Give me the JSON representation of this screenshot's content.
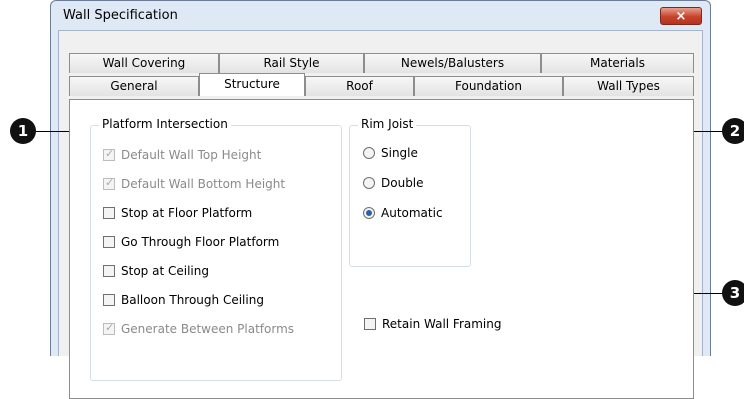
{
  "window": {
    "title": "Wall Specification",
    "close_glyph": "×"
  },
  "tabs_back": [
    "Wall Covering",
    "Rail Style",
    "Newels/Balusters",
    "Materials"
  ],
  "tabs_front": [
    "General",
    "Structure",
    "Roof",
    "Foundation",
    "Wall Types"
  ],
  "active_tab": "Structure",
  "platform_group": {
    "legend": "Platform Intersection",
    "items": [
      {
        "label": "Default Wall Top Height",
        "checked": true,
        "enabled": false
      },
      {
        "label": "Default Wall Bottom Height",
        "checked": true,
        "enabled": false
      },
      {
        "label": "Stop at Floor Platform",
        "checked": false,
        "enabled": true
      },
      {
        "label": "Go Through Floor Platform",
        "checked": false,
        "enabled": true
      },
      {
        "label": "Stop at Ceiling",
        "checked": false,
        "enabled": true
      },
      {
        "label": "Balloon Through Ceiling",
        "checked": false,
        "enabled": true
      },
      {
        "label": "Generate Between Platforms",
        "checked": true,
        "enabled": false
      }
    ]
  },
  "rim_group": {
    "legend": "Rim Joist",
    "options": [
      {
        "label": "Single",
        "selected": false
      },
      {
        "label": "Double",
        "selected": false
      },
      {
        "label": "Automatic",
        "selected": true
      }
    ]
  },
  "retain": {
    "label": "Retain Wall Framing",
    "checked": false
  },
  "callouts": [
    "1",
    "2",
    "3"
  ],
  "colors": {
    "accent": "#2d5fa8",
    "close": "#c7432b",
    "callout": "#111111"
  }
}
